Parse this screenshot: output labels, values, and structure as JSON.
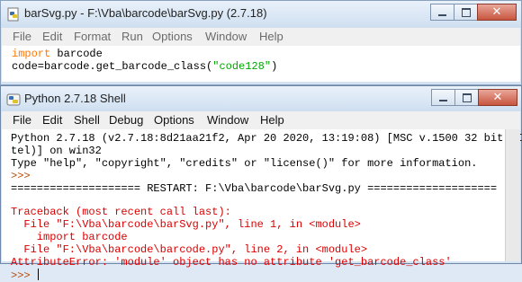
{
  "editor": {
    "title": "barSvg.py - F:\\Vba\\barcode\\barSvg.py (2.7.18)",
    "menu": [
      "File",
      "Edit",
      "Format",
      "Run",
      "Options",
      "Window",
      "Help"
    ],
    "code": {
      "line1_keyword": "import",
      "line1_rest": " barcode",
      "line2_prefix": "code=barcode.get_barcode_class(",
      "line2_string": "\"code128\"",
      "line2_suffix": ")"
    }
  },
  "shell": {
    "title": "Python 2.7.18 Shell",
    "menu": [
      "File",
      "Edit",
      "Shell",
      "Debug",
      "Options",
      "Window",
      "Help"
    ],
    "lines": {
      "banner1": "Python 2.7.18 (v2.7.18:8d21aa21f2, Apr 20 2020, 13:19:08) [MSC v.1500 32 bit (In",
      "banner2": "tel)] on win32",
      "banner3": "Type \"help\", \"copyright\", \"credits\" or \"license()\" for more information.",
      "prompt1": ">>>",
      "restart": "==================== RESTART: F:\\Vba\\barcode\\barSvg.py ====================",
      "tb1": "Traceback (most recent call last):",
      "tb2": "  File \"F:\\Vba\\barcode\\barSvg.py\", line 1, in <module>",
      "tb3": "    import barcode",
      "tb4": "  File \"F:\\Vba\\barcode\\barcode.py\", line 2, in <module>",
      "tb5": "AttributeError: 'module' object has no attribute 'get_barcode_class'",
      "prompt2": ">>> "
    }
  }
}
